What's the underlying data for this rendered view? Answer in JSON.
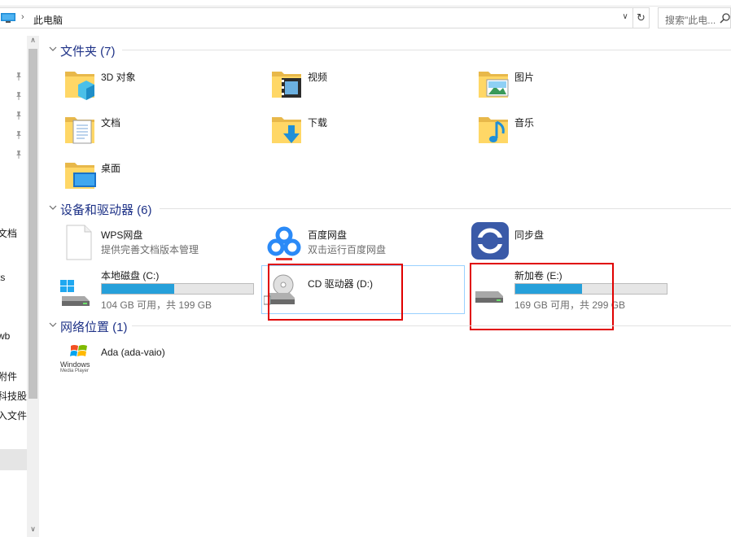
{
  "address": {
    "path_separator": "›",
    "location": "此电脑",
    "dropdown_glyph": "∨",
    "refresh_glyph": "↻",
    "search_placeholder": "搜索\"此电..."
  },
  "nav": {
    "items": [
      {
        "label": "文档"
      },
      {
        "label": "ts"
      },
      {
        "label": "wb"
      },
      {
        "label": "附件"
      },
      {
        "label": "科技股份"
      },
      {
        "label": "入文件"
      }
    ],
    "scroll_up": "∧",
    "scroll_down": "∨"
  },
  "groups": {
    "folders": {
      "title": "文件夹 (7)",
      "items": [
        {
          "label": "3D 对象",
          "icon": "3d-objects-folder-icon"
        },
        {
          "label": "视频",
          "icon": "videos-folder-icon"
        },
        {
          "label": "图片",
          "icon": "pictures-folder-icon"
        },
        {
          "label": "文档",
          "icon": "documents-folder-icon"
        },
        {
          "label": "下载",
          "icon": "downloads-folder-icon"
        },
        {
          "label": "音乐",
          "icon": "music-folder-icon"
        },
        {
          "label": "桌面",
          "icon": "desktop-folder-icon"
        }
      ]
    },
    "devices": {
      "title": "设备和驱动器 (6)",
      "items": [
        {
          "label": "WPS网盘",
          "sub": "提供完善文档版本管理",
          "icon": "wps-cloud-icon"
        },
        {
          "label": "百度网盘",
          "sub": "双击运行百度网盘",
          "icon": "baidu-netdisk-icon"
        },
        {
          "label": "同步盘",
          "sub": "",
          "icon": "sync-disk-icon"
        },
        {
          "label": "本地磁盘 (C:)",
          "sub": "104 GB 可用，共 199 GB",
          "used_fraction": 0.48,
          "icon": "windows-drive-icon"
        },
        {
          "label": "CD 驱动器 (D:)",
          "sub": "",
          "icon": "cd-drive-icon"
        },
        {
          "label": "新加卷 (E:)",
          "sub": "169 GB 可用，共 299 GB",
          "used_fraction": 0.44,
          "icon": "hard-drive-icon"
        }
      ]
    },
    "network": {
      "title": "网络位置 (1)",
      "items": [
        {
          "label": "Ada (ada-vaio)",
          "icon": "windows-media-player-icon",
          "logo_text_1": "Windows",
          "logo_text_2": "Media Player"
        }
      ]
    }
  },
  "colors": {
    "accent_bar": "#26a0da",
    "group_title": "#1e3287",
    "highlight_box": "#e00000"
  }
}
